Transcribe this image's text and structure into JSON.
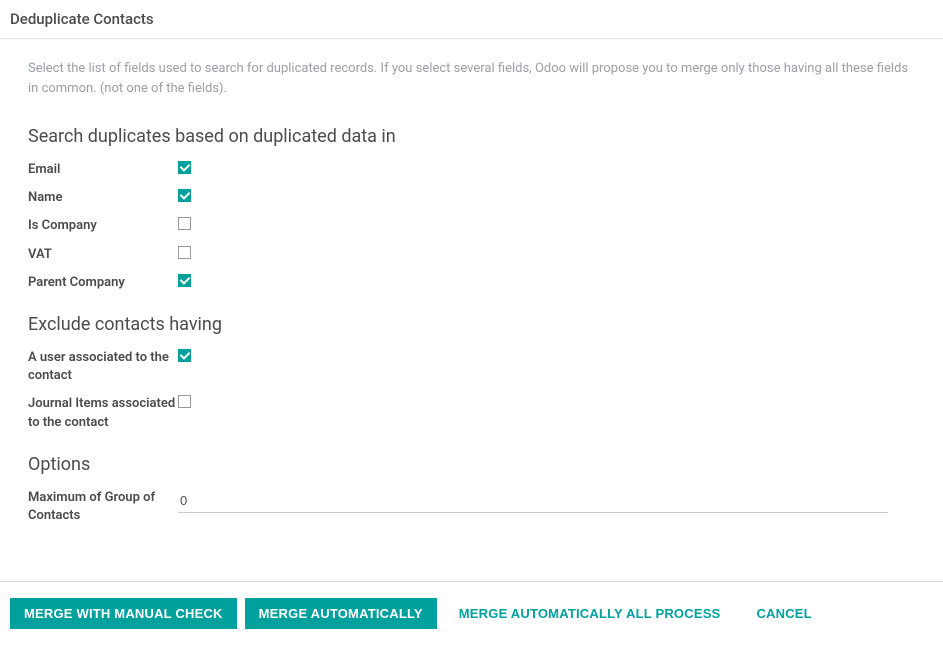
{
  "header": {
    "title": "Deduplicate Contacts"
  },
  "help_text": "Select the list of fields used to search for duplicated records. If you select several fields, Odoo will propose you to merge only those having all these fields in common. (not one of the fields).",
  "sections": {
    "search_duplicates": {
      "title": "Search duplicates based on duplicated data in",
      "fields": {
        "email": {
          "label": "Email",
          "checked": true
        },
        "name": {
          "label": "Name",
          "checked": true
        },
        "is_company": {
          "label": "Is Company",
          "checked": false
        },
        "vat": {
          "label": "VAT",
          "checked": false
        },
        "parent_company": {
          "label": "Parent Company",
          "checked": true
        }
      }
    },
    "exclude_contacts": {
      "title": "Exclude contacts having",
      "fields": {
        "user_associated": {
          "label": "A user associated to the contact",
          "checked": true
        },
        "journal_items": {
          "label": "Journal Items associated to the contact",
          "checked": false
        }
      }
    },
    "options": {
      "title": "Options",
      "fields": {
        "max_group": {
          "label": "Maximum of Group of Contacts",
          "value": "0"
        }
      }
    }
  },
  "footer": {
    "merge_manual": "Merge with Manual Check",
    "merge_auto": "Merge Automatically",
    "merge_auto_all": "Merge Automatically all process",
    "cancel": "Cancel"
  }
}
